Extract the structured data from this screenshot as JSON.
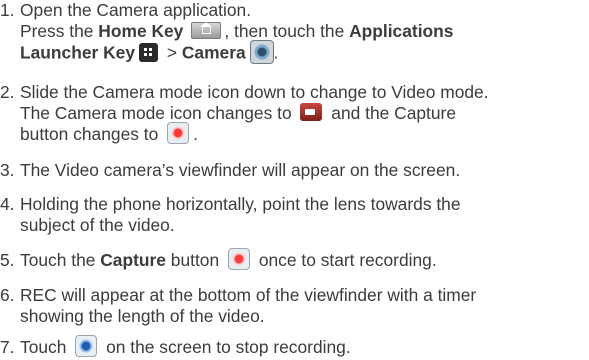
{
  "steps": [
    {
      "num": "1.",
      "lines": [
        "Open the Camera application.",
        "Press the ",
        "Home Key",
        ", then touch the ",
        "Applications",
        "Launcher Key",
        " > ",
        "Camera",
        "."
      ],
      "icons": [
        "home-key-icon",
        "applications-launcher-icon",
        "camera-app-icon"
      ]
    },
    {
      "num": "2.",
      "lines": [
        "Slide the Camera mode icon down to change to Video mode.",
        "The Camera mode icon changes to ",
        " and the Capture",
        "button changes to ",
        "."
      ],
      "icons": [
        "video-mode-icon",
        "capture-button-icon"
      ]
    },
    {
      "num": "3.",
      "lines": [
        "The Video camera’s viewfinder will appear on the screen."
      ]
    },
    {
      "num": "4.",
      "lines": [
        "Holding the phone horizontally, point the lens towards the",
        "subject of the video."
      ]
    },
    {
      "num": "5.",
      "lines": [
        "Touch the ",
        "Capture",
        " button ",
        " once to start recording."
      ],
      "icons": [
        "capture-button-icon"
      ]
    },
    {
      "num": "6.",
      "lines": [
        "REC will appear at the bottom of the viewfinder with a timer",
        "showing the length of the video."
      ]
    },
    {
      "num": "7.",
      "lines": [
        "Touch ",
        " on the screen to stop recording."
      ],
      "icons": [
        "stop-button-icon"
      ]
    }
  ]
}
